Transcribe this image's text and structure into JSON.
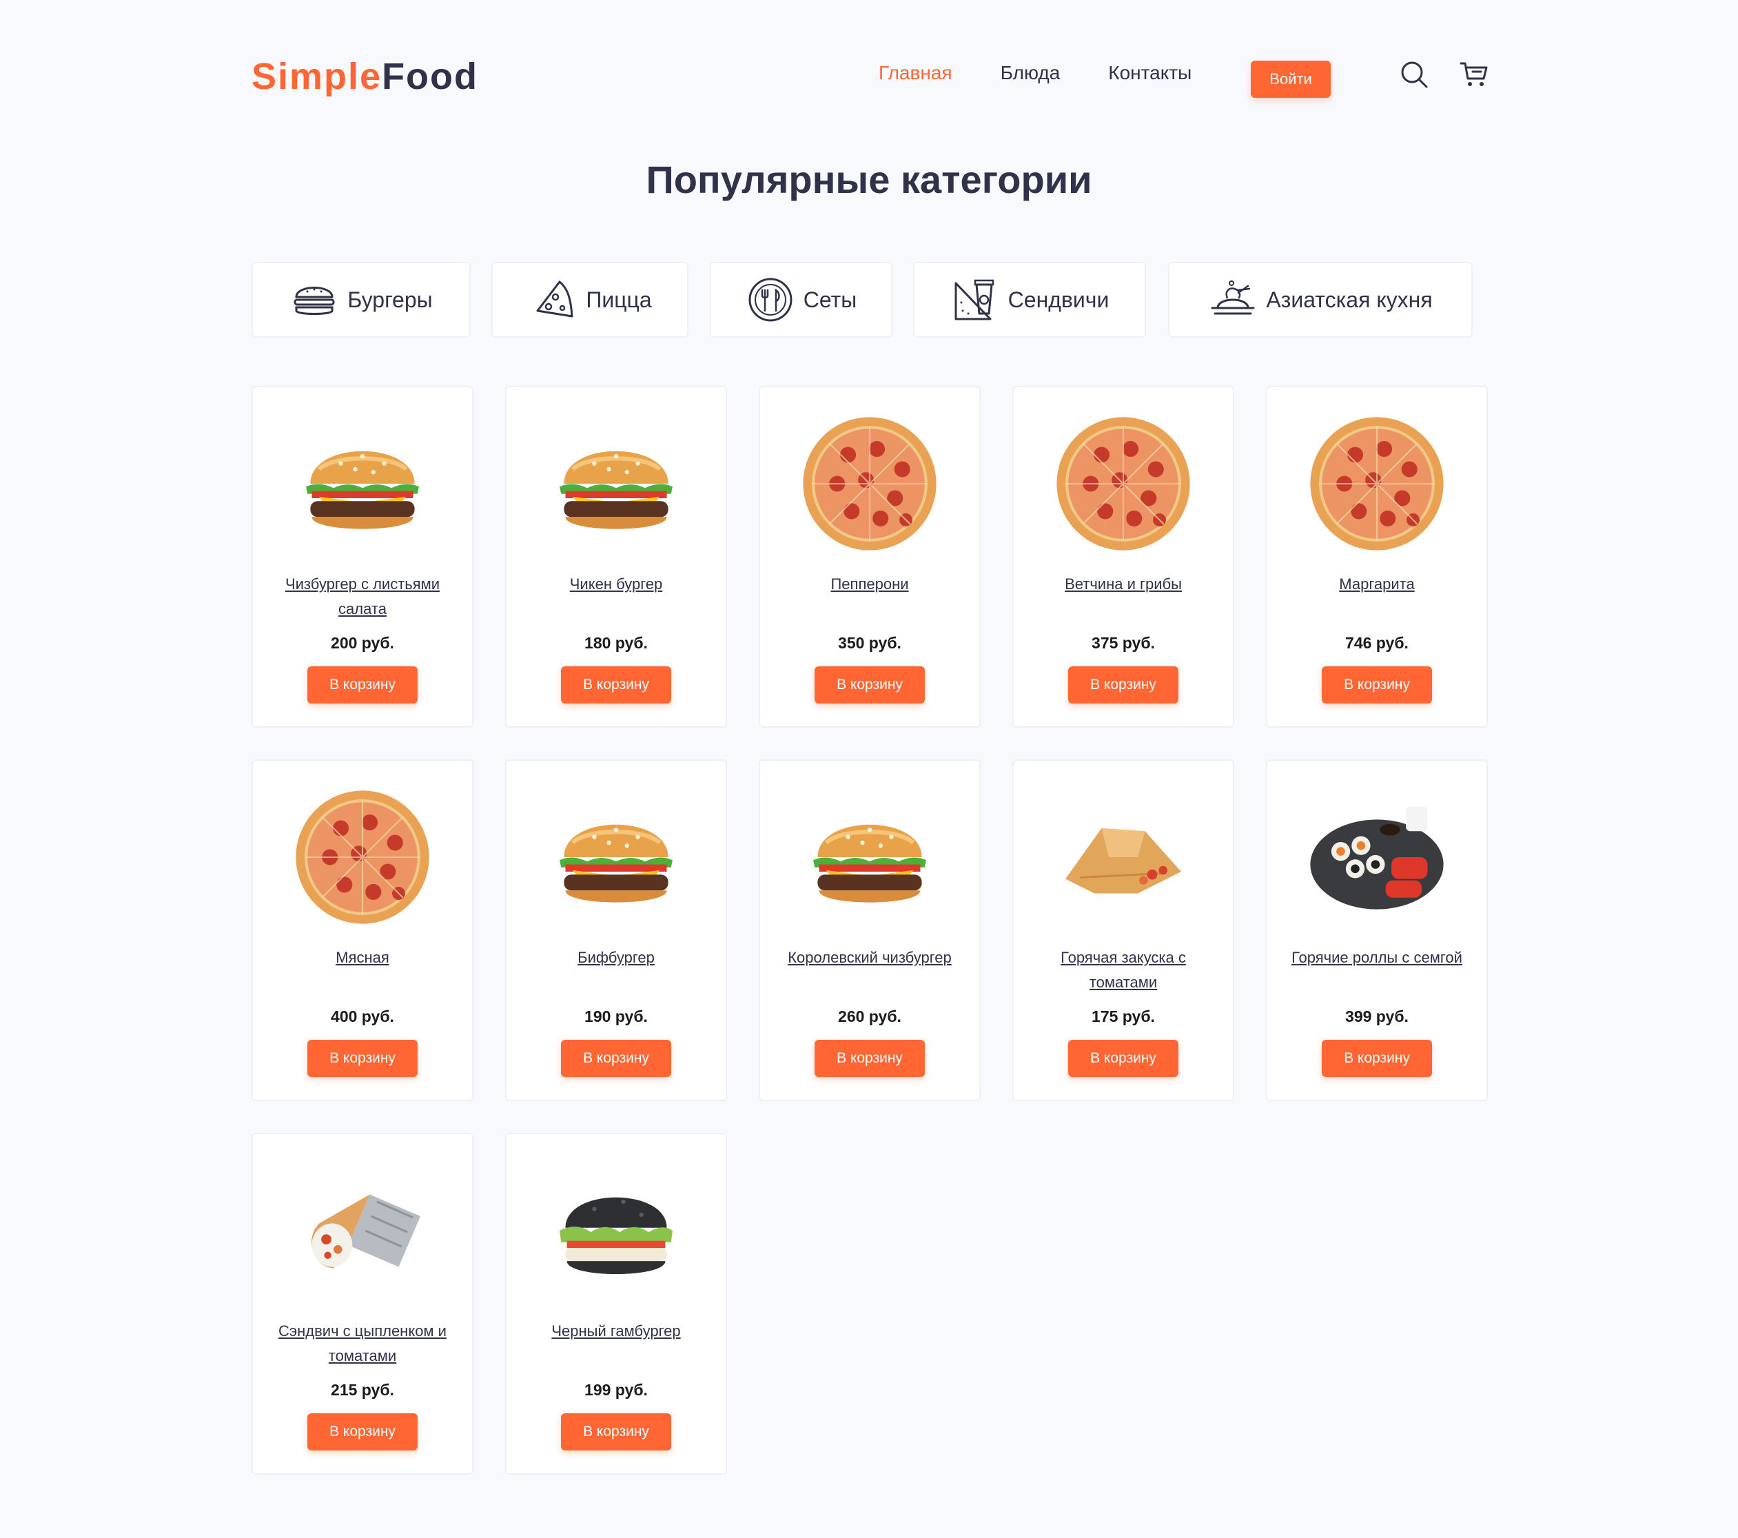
{
  "header": {
    "logo_part1": "Simple",
    "logo_part2": "Food",
    "nav": [
      {
        "label": "Главная",
        "active": true
      },
      {
        "label": "Блюда",
        "active": false
      },
      {
        "label": "Контакты",
        "active": false
      }
    ],
    "login_label": "Войти",
    "icons": [
      "search-icon",
      "cart-icon"
    ]
  },
  "title": "Популярные категории",
  "categories": [
    {
      "label": "Бургеры",
      "icon": "burger-icon"
    },
    {
      "label": "Пицца",
      "icon": "pizza-slice-icon"
    },
    {
      "label": "Сеты",
      "icon": "plate-cutlery-icon"
    },
    {
      "label": "Сендвичи",
      "icon": "sandwich-icon"
    },
    {
      "label": "Азиатская кухня",
      "icon": "asian-food-icon"
    }
  ],
  "products": [
    {
      "name": "Чизбургер с листьями салата",
      "price": "200 руб.",
      "image": "burger",
      "button": "В корзину"
    },
    {
      "name": "Чикен бургер",
      "price": "180 руб.",
      "image": "burger",
      "button": "В корзину"
    },
    {
      "name": "Пепперони",
      "price": "350 руб.",
      "image": "pizza",
      "button": "В корзину"
    },
    {
      "name": "Ветчина и грибы",
      "price": "375 руб.",
      "image": "pizza",
      "button": "В корзину"
    },
    {
      "name": "Маргарита",
      "price": "746 руб.",
      "image": "pizza",
      "button": "В корзину"
    },
    {
      "name": "Мясная",
      "price": "400 руб.",
      "image": "pizza",
      "button": "В корзину"
    },
    {
      "name": "Бифбургер",
      "price": "190 руб.",
      "image": "burger",
      "button": "В корзину"
    },
    {
      "name": "Королевский чизбургер",
      "price": "260 руб.",
      "image": "burger",
      "button": "В корзину"
    },
    {
      "name": "Горячая закуска с томатами",
      "price": "175 руб.",
      "image": "wrap",
      "button": "В корзину"
    },
    {
      "name": "Горячие роллы с семгой",
      "price": "399 руб.",
      "image": "sushi",
      "button": "В корзину"
    },
    {
      "name": "Сэндвич с цыпленком и томатами",
      "price": "215 руб.",
      "image": "roll",
      "button": "В корзину"
    },
    {
      "name": "Черный гамбургер",
      "price": "199 руб.",
      "image": "black-burger",
      "button": "В корзину"
    }
  ],
  "colors": {
    "accent": "#ff6633",
    "text": "#2f3249",
    "background": "#f8f9fd"
  }
}
